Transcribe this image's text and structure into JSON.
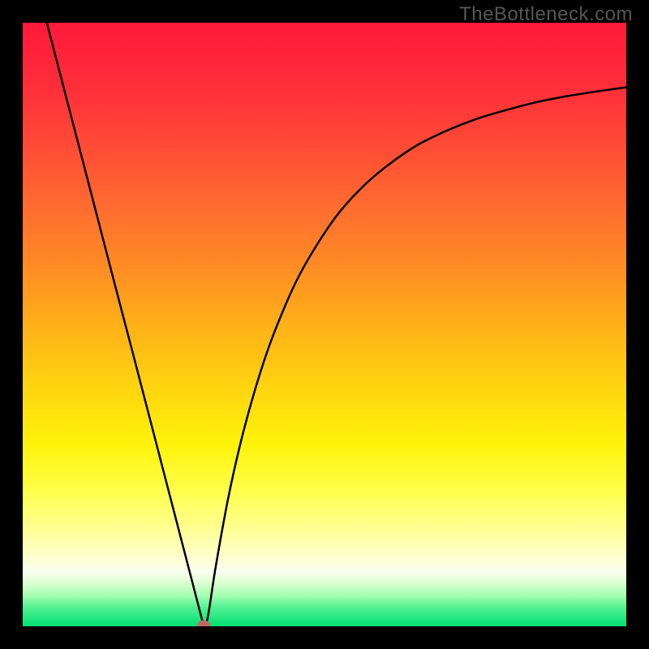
{
  "watermark": "TheBottleneck.com",
  "chart_data": {
    "type": "line",
    "title": "",
    "xlabel": "",
    "ylabel": "",
    "xlim": [
      0,
      100
    ],
    "ylim": [
      0,
      100
    ],
    "series": [
      {
        "name": "bottleneck-curve",
        "x": [
          4,
          6,
          8,
          10,
          12,
          14,
          16,
          18,
          20,
          22,
          24,
          26,
          28,
          29.5,
          30,
          30.5,
          31,
          32,
          34,
          36,
          38,
          40,
          42,
          45,
          48,
          52,
          56,
          60,
          65,
          70,
          75,
          80,
          85,
          90,
          95,
          100
        ],
        "values": [
          100,
          92.3,
          84.6,
          76.9,
          69.2,
          61.5,
          53.8,
          46.2,
          38.5,
          30.8,
          23.1,
          15.4,
          7.7,
          1.9,
          0.2,
          0.8,
          3.5,
          10,
          21,
          30,
          37.5,
          44,
          49.5,
          56.5,
          62,
          68,
          72.5,
          76,
          79.5,
          82,
          84,
          85.5,
          86.8,
          87.8,
          88.6,
          89.3
        ]
      }
    ],
    "marker": {
      "x": 30,
      "y": 0.2,
      "color": "#c06868"
    },
    "gradient_stops": [
      {
        "pos": 0.0,
        "color": "#ff1a3a"
      },
      {
        "pos": 0.1,
        "color": "#ff2c3a"
      },
      {
        "pos": 0.2,
        "color": "#ff4a36"
      },
      {
        "pos": 0.3,
        "color": "#ff6a30"
      },
      {
        "pos": 0.4,
        "color": "#ff8a24"
      },
      {
        "pos": 0.5,
        "color": "#ffb018"
      },
      {
        "pos": 0.6,
        "color": "#ffd310"
      },
      {
        "pos": 0.7,
        "color": "#fff30a"
      },
      {
        "pos": 0.78,
        "color": "#ffff50"
      },
      {
        "pos": 0.84,
        "color": "#ffff96"
      },
      {
        "pos": 0.88,
        "color": "#ffffc8"
      },
      {
        "pos": 0.91,
        "color": "#fafff0"
      },
      {
        "pos": 0.93,
        "color": "#d8ffd0"
      },
      {
        "pos": 0.95,
        "color": "#a0ffb0"
      },
      {
        "pos": 0.97,
        "color": "#50f090"
      },
      {
        "pos": 1.0,
        "color": "#00e074"
      }
    ]
  }
}
